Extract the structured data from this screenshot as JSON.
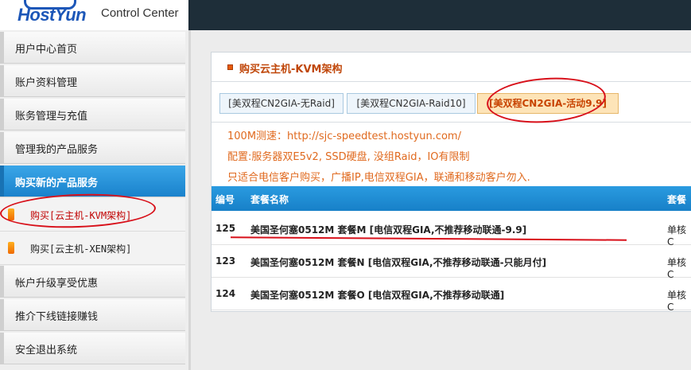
{
  "header": {
    "logo_text": "HostYun",
    "subtitle": "Control Center"
  },
  "sidebar": {
    "items": [
      {
        "label": "用户中心首页"
      },
      {
        "label": "账户资料管理"
      },
      {
        "label": "账务管理与充值"
      },
      {
        "label": "管理我的产品服务"
      },
      {
        "label": "购买新的产品服务"
      },
      {
        "label": "帐户升级享受优惠"
      },
      {
        "label": "推介下线链接赚钱"
      },
      {
        "label": "安全退出系统"
      }
    ],
    "sub_items": [
      {
        "label": "购买[云主机-KVM架构]"
      },
      {
        "label": "购买[云主机-XEN架构]"
      }
    ]
  },
  "panel": {
    "title": "购买云主机-KVM架构",
    "tabs": [
      {
        "label": "[美双程CN2GIA-无Raid]"
      },
      {
        "label": "[美双程CN2GIA-Raid10]"
      },
      {
        "label": "[美双程CN2GIA-活动9.9]"
      }
    ],
    "info": [
      "100M测速：http://sjc-speedtest.hostyun.com/",
      "配置:服务器双E5v2, SSD硬盘, 没组Raid，IO有限制",
      "只适合电信客户购买，广播IP,电信双程GIA，联通和移动客户勿入."
    ],
    "table": {
      "headers": [
        "编号",
        "套餐名称",
        "套餐"
      ],
      "rows": [
        {
          "id": "125",
          "name": "美国圣何塞0512M 套餐M [电信双程GIA,不推荐移动联通-9.9]",
          "spec": "单核C"
        },
        {
          "id": "123",
          "name": "美国圣何塞0512M 套餐N [电信双程GIA,不推荐移动联通-只能月付]",
          "spec": "单核C"
        },
        {
          "id": "124",
          "name": "美国圣何塞0512M 套餐O [电信双程GIA,不推荐移动联通]",
          "spec": "单核C"
        }
      ]
    }
  },
  "colors": {
    "accent_blue": "#1a82cc",
    "header_dark": "#1e2e39",
    "title_orange": "#c0470a",
    "annotation_red": "#d8101a"
  }
}
